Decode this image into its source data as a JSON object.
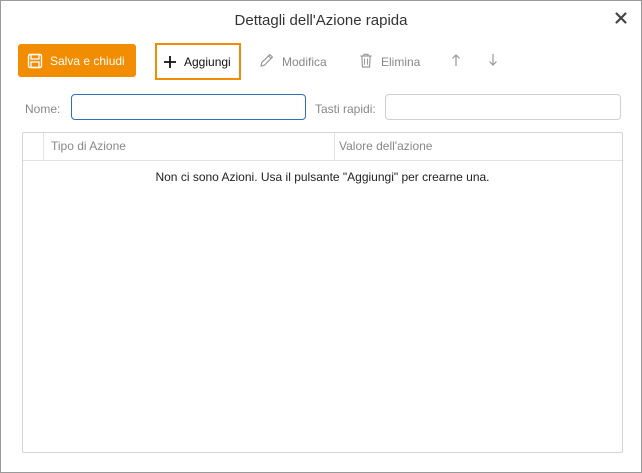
{
  "window": {
    "title": "Dettagli dell'Azione rapida",
    "close_icon": "close-icon"
  },
  "toolbar": {
    "save_label": "Salva e chiudi",
    "add_label": "Aggiungi",
    "edit_label": "Modifica",
    "delete_label": "Elimina",
    "icons": [
      "save-icon",
      "plus-icon",
      "pencil-icon",
      "trash-icon",
      "arrow-up-icon",
      "arrow-down-icon"
    ]
  },
  "form": {
    "name_label": "Nome:",
    "name_value": "",
    "hotkeys_label": "Tasti rapidi:",
    "hotkeys_value": ""
  },
  "table": {
    "columns": [
      "Tipo di Azione",
      "Valore dell'azione"
    ],
    "empty_message": "Non ci sono Azioni. Usa il pulsante \"Aggiungi\" per crearne una."
  },
  "colors": {
    "accent": "#f28c00",
    "focus_border": "#2f6fb5",
    "disabled_text": "#888888"
  }
}
